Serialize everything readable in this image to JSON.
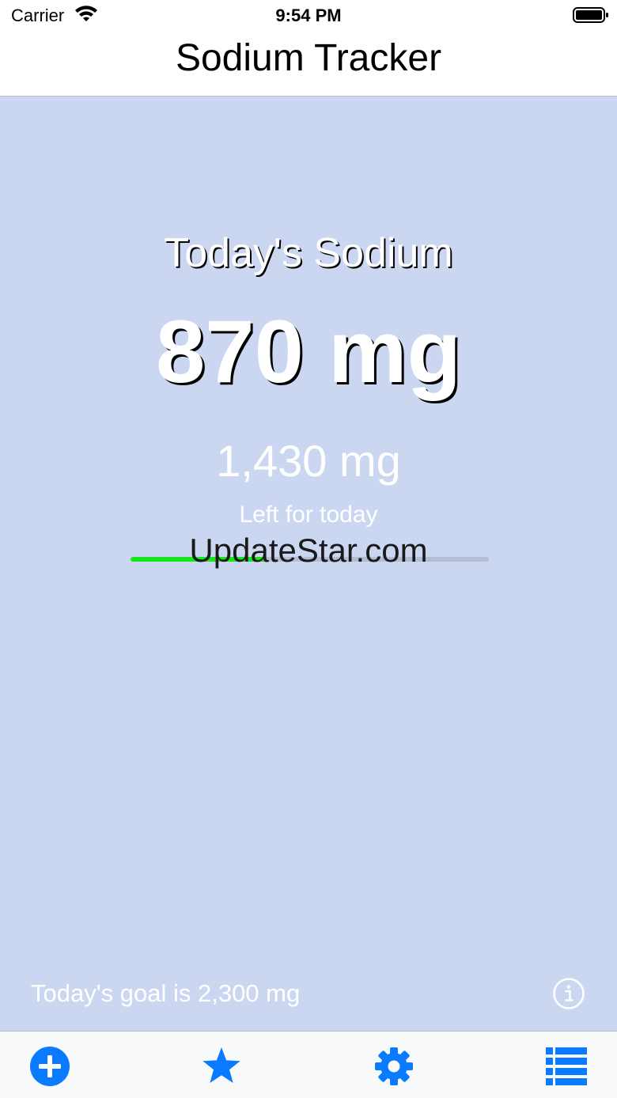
{
  "status_bar": {
    "carrier": "Carrier",
    "time": "9:54 PM"
  },
  "nav": {
    "title": "Sodium Tracker"
  },
  "summary": {
    "heading": "Today's Sodium",
    "consumed": "870 mg",
    "remaining": "1,430 mg",
    "remaining_label": "Left for today",
    "progress_fraction": 0.378
  },
  "watermark": "UpdateStar.com",
  "footer": {
    "goal_text": "Today's goal is 2,300 mg"
  },
  "tabs": [
    {
      "icon": "plus-circle-icon"
    },
    {
      "icon": "star-icon"
    },
    {
      "icon": "gear-icon"
    },
    {
      "icon": "list-icon"
    }
  ],
  "colors": {
    "background": "#cbd7f1",
    "accent": "#0a7aff",
    "progress": "#19e61a"
  }
}
